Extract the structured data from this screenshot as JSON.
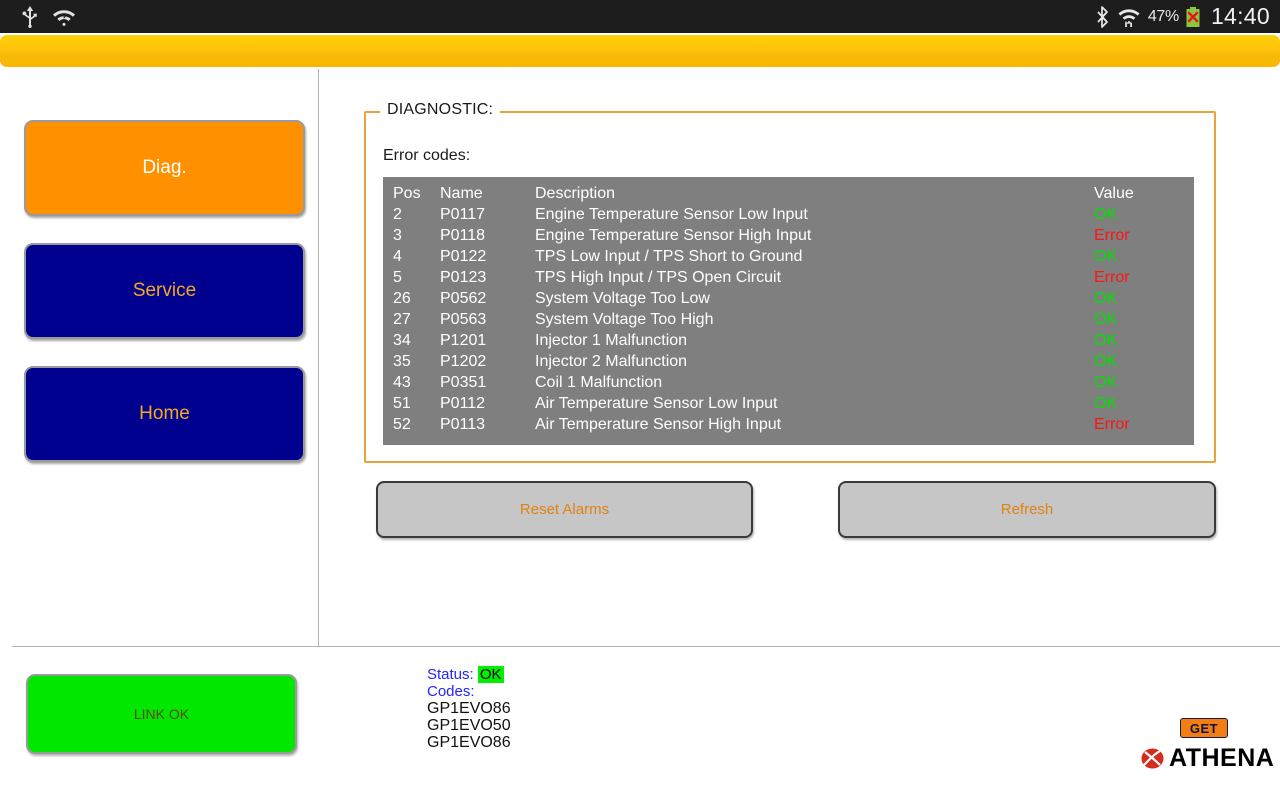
{
  "statusbar": {
    "left_icons": [
      {
        "name": "usb-icon",
        "glyph": "usb"
      },
      {
        "name": "wifi-unknown-icon",
        "glyph": "wifi-question"
      }
    ],
    "right_icons": [
      {
        "name": "bluetooth-icon",
        "glyph": "bluetooth"
      },
      {
        "name": "wifi-transfer-icon",
        "glyph": "wifi-arrows"
      }
    ],
    "battery_percent": "47%",
    "battery_state": "error",
    "time": "14:40"
  },
  "sidebar": {
    "buttons": [
      {
        "label": "Diag.",
        "active": true
      },
      {
        "label": "Service",
        "active": false
      },
      {
        "label": "Home",
        "active": false
      }
    ]
  },
  "panel": {
    "title": "DIAGNOSTIC:",
    "section_label": "Error codes:"
  },
  "table": {
    "columns": [
      "Pos",
      "Name",
      "Description",
      "Value"
    ],
    "rows": [
      {
        "pos": "2",
        "name": "P0117",
        "description": "Engine Temperature Sensor Low Input",
        "value": "OK"
      },
      {
        "pos": "3",
        "name": "P0118",
        "description": "Engine Temperature Sensor High Input",
        "value": "Error"
      },
      {
        "pos": "4",
        "name": "P0122",
        "description": "TPS Low Input / TPS Short to Ground",
        "value": "OK"
      },
      {
        "pos": "5",
        "name": "P0123",
        "description": "TPS High Input / TPS Open Circuit",
        "value": "Error"
      },
      {
        "pos": "26",
        "name": "P0562",
        "description": "System Voltage Too Low",
        "value": "OK"
      },
      {
        "pos": "27",
        "name": "P0563",
        "description": "System Voltage Too High",
        "value": "OK"
      },
      {
        "pos": "34",
        "name": "P1201",
        "description": "Injector 1 Malfunction",
        "value": "OK"
      },
      {
        "pos": "35",
        "name": "P1202",
        "description": "Injector 2 Malfunction",
        "value": "OK"
      },
      {
        "pos": "43",
        "name": "P0351",
        "description": "Coil 1 Malfunction",
        "value": "OK"
      },
      {
        "pos": "51",
        "name": "P0112",
        "description": "Air Temperature Sensor Low Input",
        "value": "OK"
      },
      {
        "pos": "52",
        "name": "P0113",
        "description": "Air Temperature Sensor High Input",
        "value": "Error"
      }
    ]
  },
  "actions": {
    "reset_label": "Reset Alarms",
    "refresh_label": "Refresh"
  },
  "footer": {
    "link_button_label": "LINK OK",
    "status_key": "Status:",
    "status_value": "OK",
    "codes_key": "Codes:",
    "codes": [
      "GP1EVO86",
      "GP1EVO50",
      "GP1EVO86"
    ]
  },
  "brand": {
    "get_label": "GET",
    "athena_label": "ATHENA"
  },
  "colors": {
    "accent_orange": "#ff9000",
    "nav_blue": "#00008f",
    "ok_green": "#00e000",
    "error_red": "#ff1414",
    "title_bar_yellow": "#fdd008",
    "table_gray": "#7f7f7f"
  }
}
